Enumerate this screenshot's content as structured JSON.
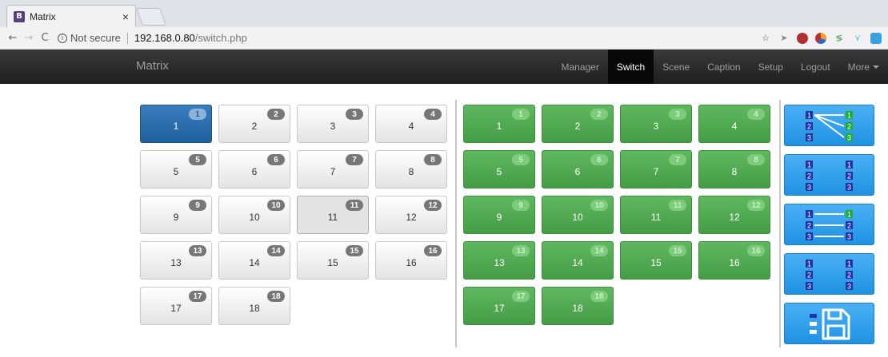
{
  "browser": {
    "tab_title": "Matrix",
    "tab_favicon": "B",
    "tab_close": "×",
    "not_secure": "Not secure",
    "url_host": "192.168.0.80",
    "url_path": "/switch.php",
    "back": "←",
    "forward": "→",
    "reload": "C",
    "star": "☆"
  },
  "app": {
    "brand": "Matrix",
    "menu": [
      "Manager",
      "Switch",
      "Scene",
      "Caption",
      "Setup",
      "Logout",
      "More"
    ],
    "active_menu": "Switch"
  },
  "inputs": {
    "selected": 1,
    "hovered": 11,
    "items": [
      {
        "label": "1",
        "badge": "1"
      },
      {
        "label": "2",
        "badge": "2"
      },
      {
        "label": "3",
        "badge": "3"
      },
      {
        "label": "4",
        "badge": "4"
      },
      {
        "label": "5",
        "badge": "5"
      },
      {
        "label": "6",
        "badge": "6"
      },
      {
        "label": "7",
        "badge": "7"
      },
      {
        "label": "8",
        "badge": "8"
      },
      {
        "label": "9",
        "badge": "9"
      },
      {
        "label": "10",
        "badge": "10"
      },
      {
        "label": "11",
        "badge": "11"
      },
      {
        "label": "12",
        "badge": "12"
      },
      {
        "label": "13",
        "badge": "13"
      },
      {
        "label": "14",
        "badge": "14"
      },
      {
        "label": "15",
        "badge": "15"
      },
      {
        "label": "16",
        "badge": "16"
      },
      {
        "label": "17",
        "badge": "17"
      },
      {
        "label": "18",
        "badge": "18"
      }
    ]
  },
  "outputs": {
    "items": [
      {
        "label": "1",
        "badge": "1"
      },
      {
        "label": "2",
        "badge": "2"
      },
      {
        "label": "3",
        "badge": "3"
      },
      {
        "label": "4",
        "badge": "4"
      },
      {
        "label": "5",
        "badge": "5"
      },
      {
        "label": "6",
        "badge": "6"
      },
      {
        "label": "7",
        "badge": "7"
      },
      {
        "label": "8",
        "badge": "8"
      },
      {
        "label": "9",
        "badge": "9"
      },
      {
        "label": "10",
        "badge": "10"
      },
      {
        "label": "11",
        "badge": "11"
      },
      {
        "label": "12",
        "badge": "12"
      },
      {
        "label": "13",
        "badge": "13"
      },
      {
        "label": "14",
        "badge": "14"
      },
      {
        "label": "15",
        "badge": "15"
      },
      {
        "label": "16",
        "badge": "16"
      },
      {
        "label": "17",
        "badge": "17"
      },
      {
        "label": "18",
        "badge": "18"
      }
    ]
  },
  "presets": [
    {
      "name": "all-to-one",
      "icon": "one-to-all-icon",
      "numbers": [
        "1",
        "2",
        "3"
      ]
    },
    {
      "name": "disconnect",
      "icon": "unlinked-icon",
      "numbers": [
        "1",
        "2",
        "3"
      ]
    },
    {
      "name": "one-to-one",
      "icon": "one-to-one-icon",
      "numbers": [
        "1",
        "2",
        "3"
      ]
    },
    {
      "name": "clear",
      "icon": "unlinked-icon",
      "numbers": [
        "1",
        "2",
        "3"
      ]
    },
    {
      "name": "save",
      "icon": "save-icon"
    }
  ],
  "colors": {
    "selected_input": "#2a6eb0",
    "output_green": "#4cae4c",
    "preset_blue": "#2a9fef"
  }
}
